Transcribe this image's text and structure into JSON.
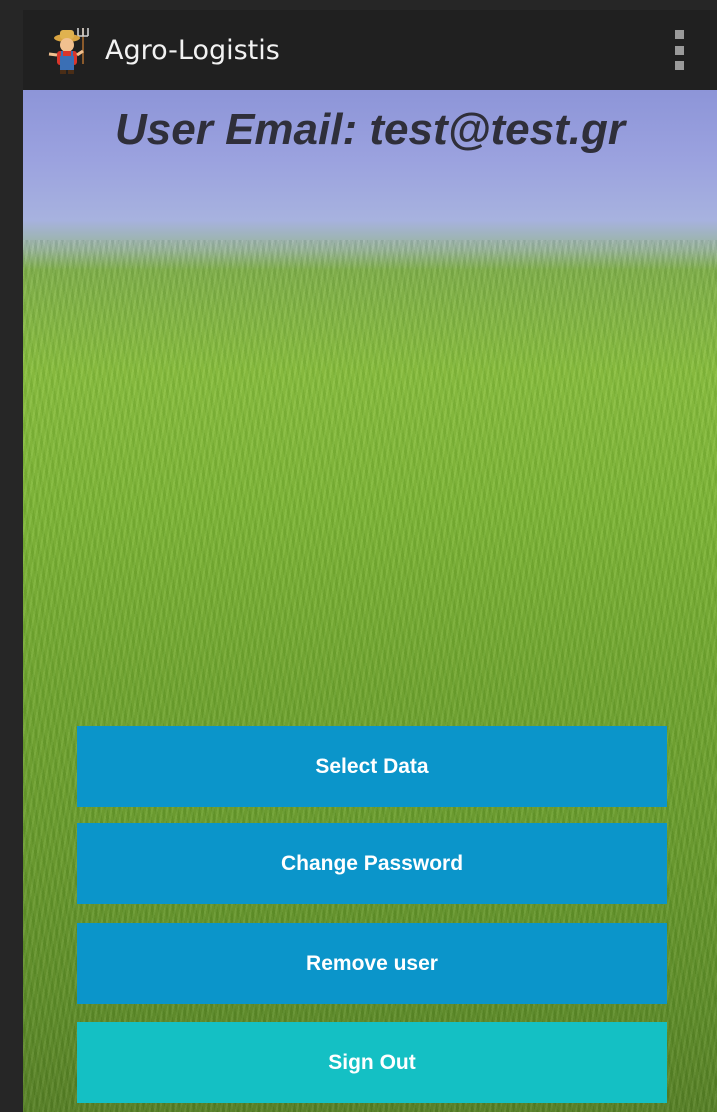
{
  "action_bar": {
    "title": "Agro-Logistis",
    "icon": "farmer-icon",
    "overflow_icon": "overflow-menu-icon"
  },
  "main": {
    "email_label": "User Email: test@test.gr",
    "buttons": [
      {
        "label": "Select Data",
        "color": "#0b95ca"
      },
      {
        "label": "Change Password",
        "color": "#0b95ca"
      },
      {
        "label": "Remove user",
        "color": "#0b95ca"
      },
      {
        "label": "Sign Out",
        "color": "#14c0c4"
      }
    ]
  },
  "colors": {
    "action_bar": "#202020",
    "primary_button": "#0b95ca",
    "signout_button": "#14c0c4",
    "email_text": "#2f2f3a"
  }
}
